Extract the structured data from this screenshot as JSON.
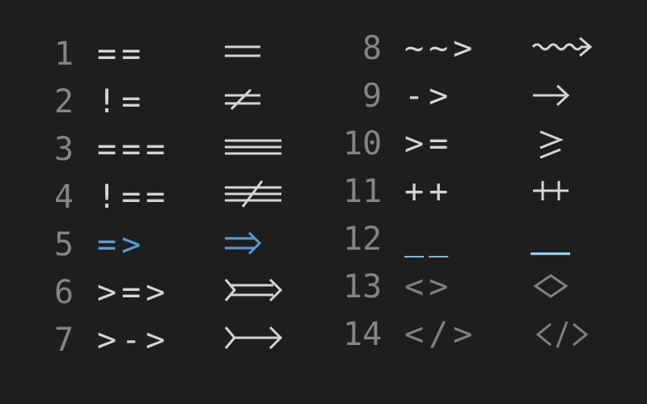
{
  "theme": {
    "line_number_color": "#858585",
    "text_color": "#d4d4d4",
    "highlight_color": "#569cd6",
    "dim_color": "#808080",
    "underscore_color": "#9cdcfe"
  },
  "left_column": [
    {
      "line": "1",
      "text": "=="
    },
    {
      "line": "2",
      "text": "!="
    },
    {
      "line": "3",
      "text": "==="
    },
    {
      "line": "4",
      "text": "!=="
    },
    {
      "line": "5",
      "text": "=>"
    },
    {
      "line": "6",
      "text": ">=>"
    },
    {
      "line": "7",
      "text": ">->"
    }
  ],
  "right_column": [
    {
      "line": "8",
      "text": "~~>"
    },
    {
      "line": "9",
      "text": "->"
    },
    {
      "line": "10",
      "text": ">="
    },
    {
      "line": "11",
      "text": "++"
    },
    {
      "line": "12",
      "text": "__"
    },
    {
      "line": "13",
      "text": "<>"
    },
    {
      "line": "14",
      "text": "</>"
    }
  ],
  "ligatures": [
    {
      "icon": "double-line-icon",
      "color": "text"
    },
    {
      "icon": "not-equal-icon",
      "color": "text"
    },
    {
      "icon": "triple-line-icon",
      "color": "text"
    },
    {
      "icon": "strict-not-equal-icon",
      "color": "text"
    },
    {
      "icon": "double-arrow-icon",
      "color": "highlight"
    },
    {
      "icon": "double-arrow-tailed-icon",
      "color": "text"
    },
    {
      "icon": "arrow-tailed-icon",
      "color": "text"
    },
    {
      "icon": "squiggly-arrow-icon",
      "color": "text"
    },
    {
      "icon": "arrow-icon",
      "color": "text"
    },
    {
      "icon": "greater-equal-icon",
      "color": "text"
    },
    {
      "icon": "plus-plus-icon",
      "color": "text"
    },
    {
      "icon": "underscore-icon",
      "color": "underscore"
    },
    {
      "icon": "diamond-icon",
      "color": "dim"
    },
    {
      "icon": "closing-tag-icon",
      "color": "dim"
    }
  ]
}
